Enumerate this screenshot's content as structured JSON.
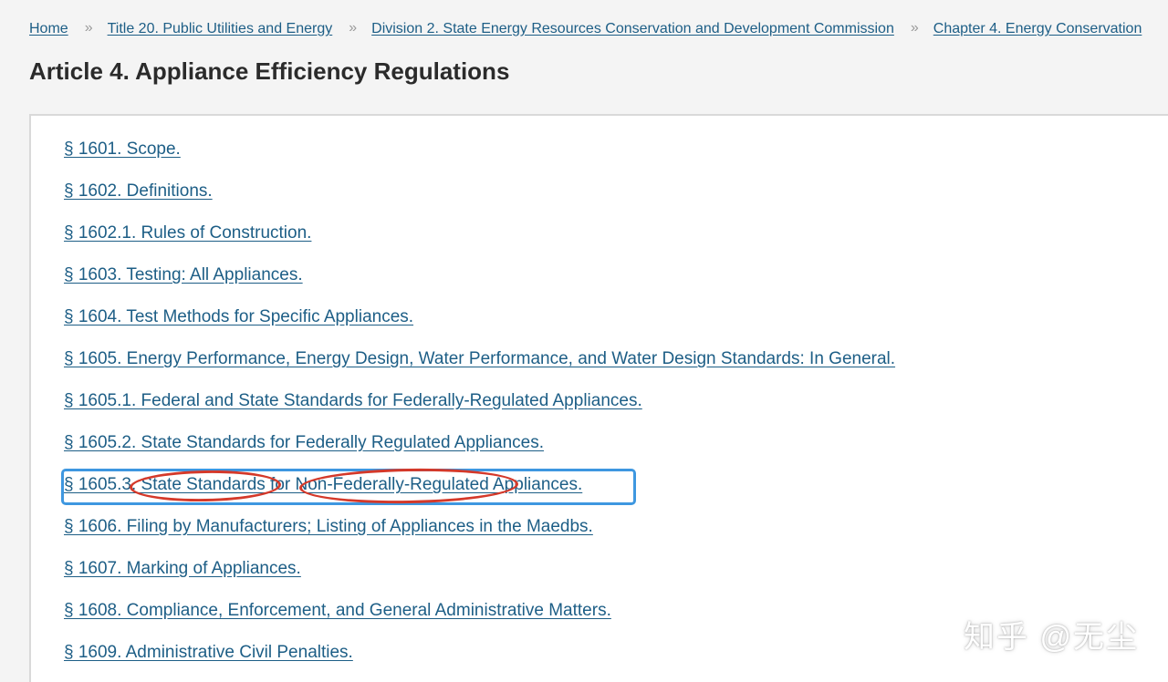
{
  "breadcrumb": {
    "items": [
      "Home",
      "Title 20. Public Utilities and Energy",
      "Division 2. State Energy Resources Conservation and Development Commission",
      "Chapter 4. Energy Conservation"
    ],
    "separator": "»"
  },
  "page_title": "Article 4. Appliance Efficiency Regulations",
  "sections": [
    "§ 1601. Scope.",
    "§ 1602. Definitions.",
    "§ 1602.1. Rules of Construction.",
    "§ 1603. Testing: All Appliances.",
    "§ 1604. Test Methods for Specific Appliances.",
    "§ 1605. Energy Performance, Energy Design, Water Performance, and Water Design Standards: In General.",
    "§ 1605.1. Federal and State Standards for Federally-Regulated Appliances.",
    "§ 1605.2. State Standards for Federally Regulated Appliances.",
    "§ 1605.3. State Standards for Non-Federally-Regulated Appliances.",
    "§ 1606. Filing by Manufacturers; Listing of Appliances in the Maedbs.",
    "§ 1607. Marking of Appliances.",
    "§ 1608. Compliance, Enforcement, and General Administrative Matters.",
    "§ 1609. Administrative Civil Penalties."
  ],
  "annotations": {
    "highlight_color": "#3e97e0",
    "circle_color": "#d4392a"
  },
  "watermark": "知乎 @无尘",
  "colors": {
    "link": "#1d5e86",
    "background": "#f4f4f4",
    "panel": "#ffffff",
    "title": "#2b2b2b"
  }
}
